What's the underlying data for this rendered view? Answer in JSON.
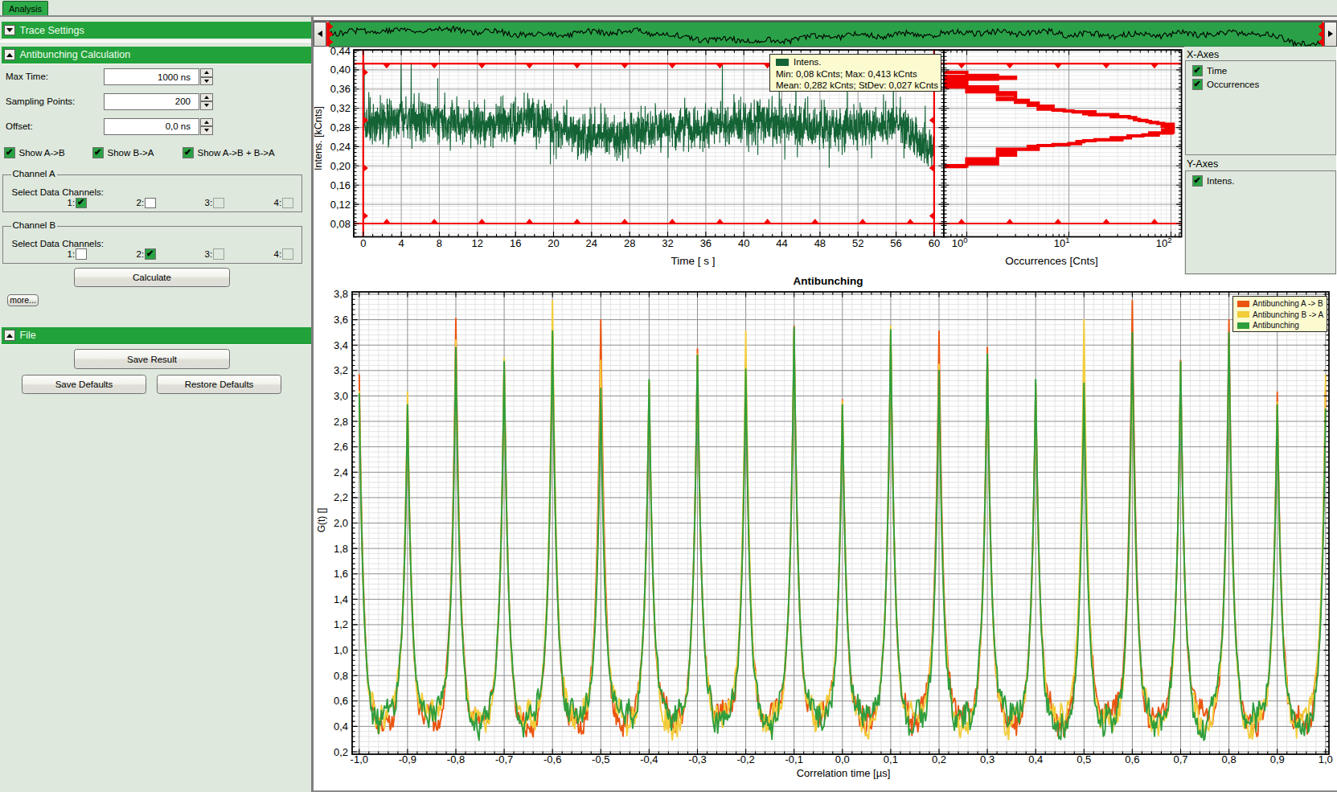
{
  "colors": {
    "panel_bg": "#dee8dd",
    "header_green": "#21a23a",
    "tab_green": "#2cab48",
    "checkbox_green": "#2aa244",
    "nav_green": "#2aa148",
    "trace_green": "#16703a",
    "cursor_red": "#f40000",
    "histogram_red": "#f20000",
    "grid_major": "#9a9a9a",
    "grid_minor": "#eaeaea",
    "tooltip_bg": "#fbfbcf"
  },
  "tab": {
    "label": "Analysis"
  },
  "sidebar": {
    "sections": {
      "trace_settings": {
        "label": "Trace Settings",
        "collapsed": true
      },
      "antibunching": {
        "label": "Antibunching Calculation",
        "collapsed": false
      },
      "file": {
        "label": "File",
        "collapsed": false
      }
    },
    "fields": {
      "max_time": {
        "label": "Max Time:",
        "value": "1000 ns"
      },
      "sampling_points": {
        "label": "Sampling Points:",
        "value": "200"
      },
      "offset": {
        "label": "Offset:",
        "value": "0,0 ns"
      }
    },
    "show_checkboxes": [
      {
        "label": "Show A->B",
        "checked": true
      },
      {
        "label": "Show B->A",
        "checked": true
      },
      {
        "label": "Show A->B + B->A",
        "checked": true
      }
    ],
    "channel_groups": [
      {
        "label": "Channel A",
        "sublabel": "Select Data Channels:",
        "channels": [
          {
            "label": "1:",
            "checked": true,
            "enabled": true
          },
          {
            "label": "2:",
            "checked": false,
            "enabled": true
          },
          {
            "label": "3:",
            "checked": false,
            "enabled": false
          },
          {
            "label": "4:",
            "checked": false,
            "enabled": false
          }
        ]
      },
      {
        "label": "Channel B",
        "sublabel": "Select Data Channels:",
        "channels": [
          {
            "label": "1:",
            "checked": false,
            "enabled": true
          },
          {
            "label": "2:",
            "checked": true,
            "enabled": true
          },
          {
            "label": "3:",
            "checked": false,
            "enabled": false
          },
          {
            "label": "4:",
            "checked": false,
            "enabled": false
          }
        ]
      }
    ],
    "buttons": {
      "calculate": "Calculate",
      "more": "more...",
      "save_result": "Save Result",
      "save_defaults": "Save Defaults",
      "restore_defaults": "Restore Defaults"
    }
  },
  "axes_panel": {
    "x_title": "X-Axes",
    "x_items": [
      {
        "label": "Time",
        "checked": true
      },
      {
        "label": "Occurrences",
        "checked": true
      }
    ],
    "y_title": "Y-Axes",
    "y_items": [
      {
        "label": "Intens.",
        "checked": true
      }
    ]
  },
  "tooltip": {
    "series": "Intens.",
    "swatch": "#136335",
    "line1": "Min: 0,08 kCnts; Max: 0,413 kCnts",
    "line2": "Mean: 0,282 kCnts; StDev: 0,027 kCnts"
  },
  "chart_data": [
    {
      "id": "intensity_trace",
      "type": "line",
      "xlabel": "Time [ s ]",
      "ylabel": "Intens. [kCnts]",
      "xlim": [
        -1.0,
        61.2
      ],
      "ylim": [
        0.052,
        0.4417
      ],
      "xticks": [
        0,
        4,
        8,
        12,
        16,
        20,
        24,
        28,
        32,
        36,
        40,
        44,
        48,
        52,
        56,
        60
      ],
      "x_minor_step": 1,
      "yticks": [
        0.08,
        0.12,
        0.16,
        0.2,
        0.24,
        0.28,
        0.32,
        0.36,
        0.4,
        0.44
      ],
      "y_minor_step": 0.008,
      "series": [
        {
          "name": "Intens.",
          "color": "#136335",
          "stats": {
            "min": 0.08,
            "max": 0.413,
            "mean": 0.282,
            "stdev": 0.027
          },
          "duration_s": 60,
          "seed": 911,
          "trend_t": [
            0,
            2,
            4,
            5,
            7,
            10,
            13,
            15,
            17,
            19,
            21,
            23,
            25,
            27,
            29,
            31,
            34,
            37,
            39,
            41,
            43,
            45,
            48,
            51,
            54,
            56,
            57.5,
            58.5,
            59.5,
            60
          ],
          "trend_v": [
            0.289,
            0.292,
            0.3,
            0.296,
            0.301,
            0.29,
            0.282,
            0.287,
            0.295,
            0.293,
            0.276,
            0.263,
            0.262,
            0.258,
            0.272,
            0.279,
            0.28,
            0.287,
            0.292,
            0.286,
            0.294,
            0.283,
            0.281,
            0.284,
            0.286,
            0.288,
            0.268,
            0.252,
            0.242,
            0.247
          ],
          "noise_sd": 0.0215
        }
      ],
      "cursors": {
        "top": 0.413,
        "bottom": 0.08,
        "left_t": 0,
        "right_t": 60
      }
    },
    {
      "id": "occurrence_histogram",
      "type": "histogram-horizontal",
      "xlabel": "Occurrences [Cnts]",
      "xscale": "log",
      "xlim": [
        0.647,
        126
      ],
      "xtick_exponents": [
        0,
        1,
        2
      ],
      "color": "#f20000",
      "seed": 421,
      "bin_width_kcnts": 0.002,
      "value_range": [
        0.195,
        0.3965
      ],
      "peak": {
        "center": 0.2815,
        "sigma": 0.014,
        "max_count": 98
      },
      "cursors": {
        "top": 0.413,
        "bottom": 0.08
      }
    },
    {
      "id": "antibunching",
      "type": "line",
      "title": "Antibunching",
      "xlabel": "Correlation time [µs]",
      "ylabel": "G(t) []",
      "xlim": [
        -1.0125,
        1.0083
      ],
      "ylim": [
        0.181,
        3.816
      ],
      "xtick_step": 0.1,
      "x_minor_step": 0.02,
      "ytick_step": 0.2,
      "y_minor_step": 0.04,
      "pulse_period_us": 0.1,
      "peak_width_us": 0.0095,
      "valley_mean": 0.4,
      "sample_step_us": 0.002,
      "peak_positions": [
        -1.0,
        -0.9,
        -0.8,
        -0.7,
        -0.6,
        -0.5,
        -0.4,
        -0.3,
        -0.2,
        -0.1,
        0.0,
        0.1,
        0.2,
        0.3,
        0.4,
        0.5,
        0.6,
        0.7,
        0.8,
        0.9,
        1.0
      ],
      "series": [
        {
          "name": "Antibunching A -> B",
          "color": "#ea5511",
          "seed": 101,
          "peak_heights": [
            3.17,
            2.94,
            3.61,
            3.28,
            3.52,
            3.6,
            3.1,
            3.37,
            3.28,
            3.55,
            2.97,
            3.5,
            3.51,
            3.38,
            3.1,
            3.3,
            3.75,
            3.28,
            3.6,
            3.03,
            3.05
          ]
        },
        {
          "name": "Antibunching B -> A",
          "color": "#f2cd39",
          "seed": 202,
          "peak_heights": [
            3.04,
            3.03,
            3.44,
            3.3,
            3.75,
            3.28,
            3.12,
            3.33,
            3.51,
            3.49,
            2.96,
            3.55,
            3.25,
            3.3,
            3.08,
            3.6,
            3.35,
            3.25,
            3.38,
            2.95,
            3.17
          ]
        },
        {
          "name": "Antibunching",
          "color": "#2f9e3d",
          "seed": 303,
          "peak_heights": [
            3.02,
            2.93,
            3.38,
            3.27,
            3.51,
            3.06,
            3.13,
            3.32,
            3.21,
            3.54,
            2.93,
            3.52,
            3.2,
            3.33,
            3.13,
            3.1,
            3.5,
            3.27,
            3.5,
            2.93,
            2.9
          ]
        }
      ],
      "legend_position": "top-right"
    }
  ],
  "navigator": {
    "seed": 77,
    "trace_color": "#000000",
    "bg": "#2aa148"
  }
}
